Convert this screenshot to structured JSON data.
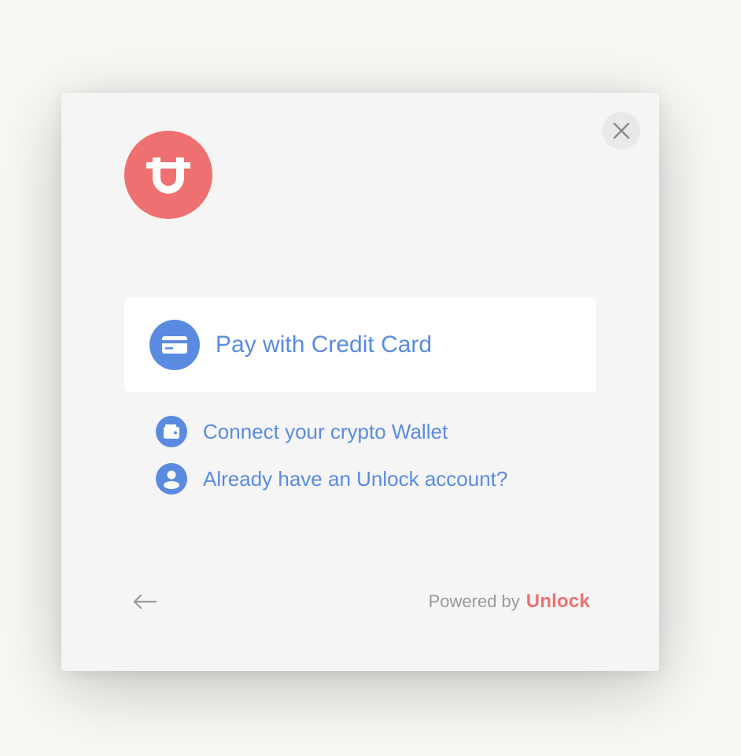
{
  "modal": {
    "logo_icon": "unlock-logo-icon",
    "close_icon": "close-icon",
    "primary_option": {
      "icon": "credit-card-icon",
      "label": "Pay with Credit Card"
    },
    "options": [
      {
        "icon": "wallet-icon",
        "label": "Connect your crypto Wallet"
      },
      {
        "icon": "user-icon",
        "label": "Already have an Unlock account?"
      }
    ],
    "footer": {
      "back_icon": "arrow-left-icon",
      "powered_by": "Powered by",
      "brand": "Unlock"
    }
  },
  "colors": {
    "brand": "#ef7070",
    "accent": "#5a8be0",
    "muted": "#999999",
    "modal_bg": "#f5f5f5"
  }
}
